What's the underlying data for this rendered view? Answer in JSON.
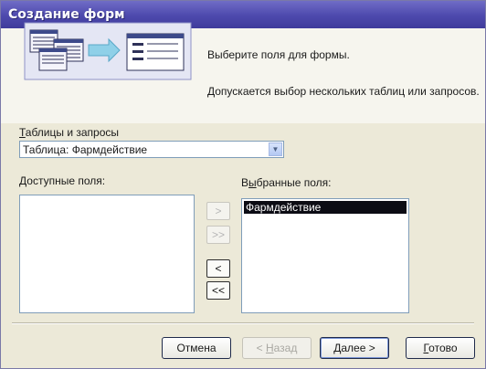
{
  "window": {
    "title": "Создание форм"
  },
  "intro": {
    "line1": "Выберите поля для формы.",
    "line2": "Допускается выбор нескольких таблиц или запросов."
  },
  "tables": {
    "label_underlined": "Т",
    "label_rest": "аблицы и запросы",
    "selected": "Таблица: Фармдействие",
    "dropdown_icon": "chevron-down-icon"
  },
  "available": {
    "label_underlined": "Д",
    "label_rest": "оступные поля:",
    "items": []
  },
  "selected": {
    "label_pre": "В",
    "label_underlined": "ы",
    "label_rest": "бранные поля:",
    "items": [
      "Фармдействие"
    ]
  },
  "transfer": {
    "add_one": ">",
    "add_all": ">>",
    "remove_one": "<",
    "remove_all": "<<"
  },
  "buttons": {
    "cancel": "Отмена",
    "back_pre": "< ",
    "back_underlined": "Н",
    "back_rest": "азад",
    "next_underlined": "Д",
    "next_rest": "алее >",
    "finish_underlined": "Г",
    "finish_rest": "отово"
  },
  "colors": {
    "titlebar": "#4d49ad",
    "selection": "#0c0c14",
    "window_bg": "#ece9d8"
  }
}
